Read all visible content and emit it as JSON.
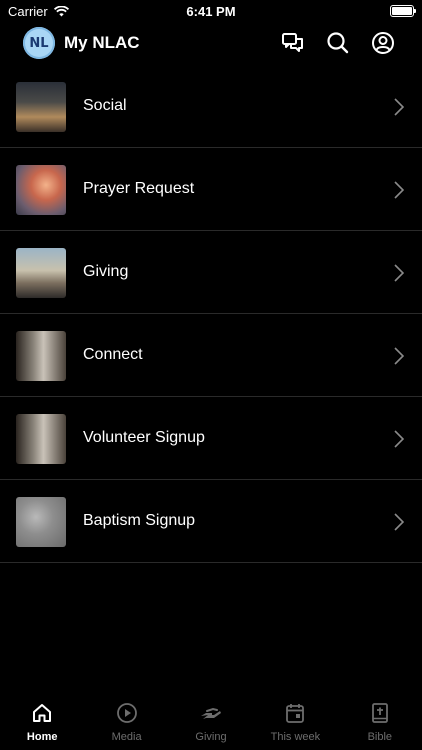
{
  "status_bar": {
    "carrier": "Carrier",
    "time": "6:41 PM"
  },
  "header": {
    "title": "My NLAC",
    "logo_text": "NL"
  },
  "list": [
    {
      "label": "Social",
      "thumb": "t-social"
    },
    {
      "label": "Prayer Request",
      "thumb": "t-prayer"
    },
    {
      "label": "Giving",
      "thumb": "t-giving"
    },
    {
      "label": "Connect",
      "thumb": "t-connect"
    },
    {
      "label": "Volunteer Signup",
      "thumb": "t-volunteer"
    },
    {
      "label": "Baptism Signup",
      "thumb": "t-baptism"
    }
  ],
  "tabs": [
    {
      "label": "Home",
      "icon": "home-icon",
      "active": true
    },
    {
      "label": "Media",
      "icon": "play-icon",
      "active": false
    },
    {
      "label": "Giving",
      "icon": "giving-hand-icon",
      "active": false
    },
    {
      "label": "This week",
      "icon": "calendar-icon",
      "active": false
    },
    {
      "label": "Bible",
      "icon": "bible-icon",
      "active": false
    }
  ],
  "colors": {
    "background": "#000000",
    "active_tab": "#ffffff",
    "inactive_tab": "#6d6d6d",
    "divider": "#2a2a2a"
  }
}
